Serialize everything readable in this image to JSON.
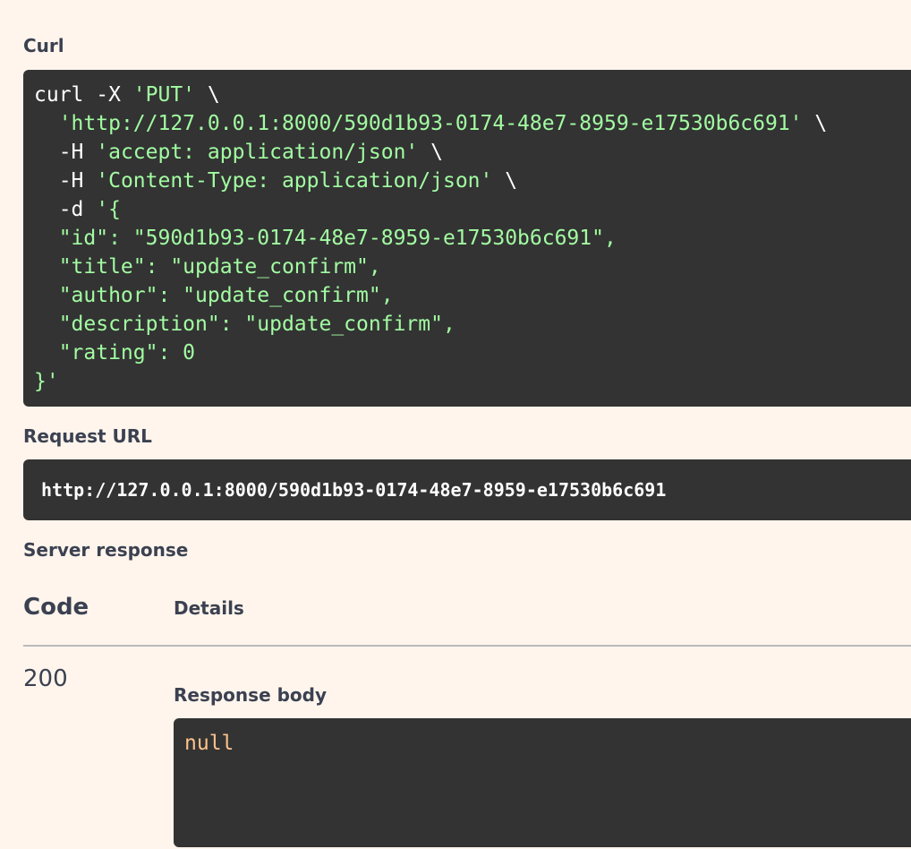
{
  "curl": {
    "label": "Curl",
    "lines": [
      [
        {
          "t": "curl -X ",
          "c": "plain"
        },
        {
          "t": "'PUT'",
          "c": "str"
        },
        {
          "t": " \\",
          "c": "plain"
        }
      ],
      [
        {
          "t": "  ",
          "c": "plain"
        },
        {
          "t": "'http://127.0.0.1:8000/590d1b93-0174-48e7-8959-e17530b6c691'",
          "c": "str"
        },
        {
          "t": " \\",
          "c": "plain"
        }
      ],
      [
        {
          "t": "  -H ",
          "c": "plain"
        },
        {
          "t": "'accept: application/json'",
          "c": "str"
        },
        {
          "t": " \\",
          "c": "plain"
        }
      ],
      [
        {
          "t": "  -H ",
          "c": "plain"
        },
        {
          "t": "'Content-Type: application/json'",
          "c": "str"
        },
        {
          "t": " \\",
          "c": "plain"
        }
      ],
      [
        {
          "t": "  -d ",
          "c": "plain"
        },
        {
          "t": "'{",
          "c": "str"
        }
      ],
      [
        {
          "t": "  \"id\": \"590d1b93-0174-48e7-8959-e17530b6c691\",",
          "c": "str"
        }
      ],
      [
        {
          "t": "  \"title\": \"update_confirm\",",
          "c": "str"
        }
      ],
      [
        {
          "t": "  \"author\": \"update_confirm\",",
          "c": "str"
        }
      ],
      [
        {
          "t": "  \"description\": \"update_confirm\",",
          "c": "str"
        }
      ],
      [
        {
          "t": "  \"rating\": 0",
          "c": "str"
        }
      ],
      [
        {
          "t": "}'",
          "c": "str"
        }
      ]
    ]
  },
  "request_url": {
    "label": "Request URL",
    "value": "http://127.0.0.1:8000/590d1b93-0174-48e7-8959-e17530b6c691"
  },
  "server_response": {
    "label": "Server response",
    "col_code": "Code",
    "col_details": "Details",
    "status_code": "200",
    "response_body_label": "Response body",
    "response_body": "null"
  },
  "colors": {
    "background": "#fff5ec",
    "code_bg": "#333333",
    "string": "#a2fca2",
    "response_value": "#fcc28c"
  }
}
